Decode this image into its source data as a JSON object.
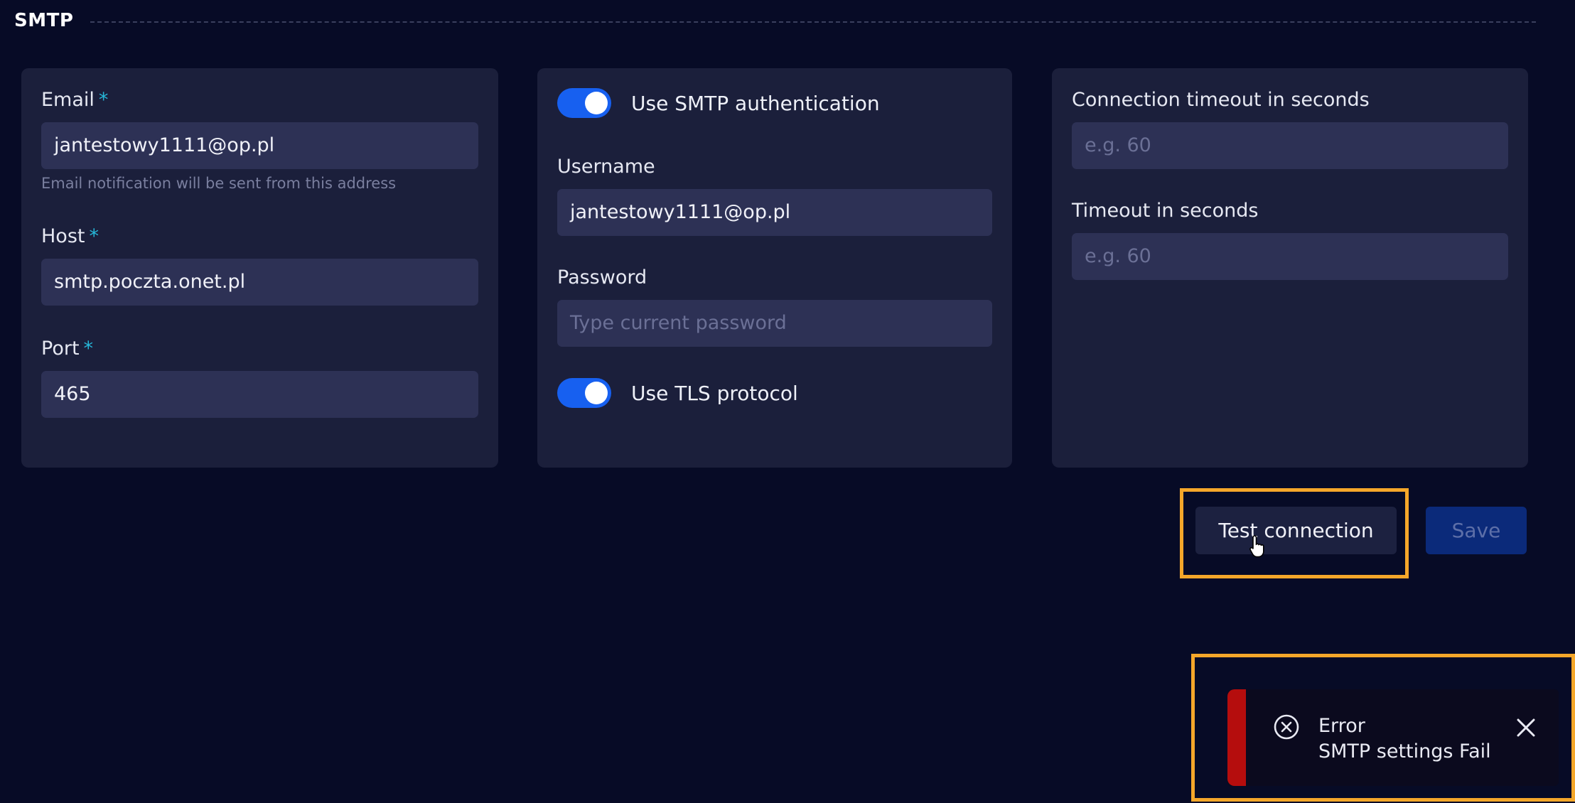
{
  "section": {
    "title": "SMTP"
  },
  "email_card": {
    "email_label": "Email",
    "email_value": "jantestowy1111@op.pl",
    "email_hint": "Email notification will be sent from this address",
    "host_label": "Host",
    "host_value": "smtp.poczta.onet.pl",
    "port_label": "Port",
    "port_value": "465",
    "required_mark": "*"
  },
  "auth_card": {
    "smtp_auth_label": "Use SMTP authentication",
    "smtp_auth_enabled": true,
    "username_label": "Username",
    "username_value": "jantestowy1111@op.pl",
    "password_label": "Password",
    "password_placeholder": "Type current password",
    "tls_label": "Use TLS protocol",
    "tls_enabled": true
  },
  "timeout_card": {
    "connection_timeout_label": "Connection timeout in seconds",
    "connection_timeout_placeholder": "e.g. 60",
    "timeout_label": "Timeout in seconds",
    "timeout_placeholder": "e.g. 60"
  },
  "actions": {
    "test_connection_label": "Test connection",
    "save_label": "Save"
  },
  "toast": {
    "title": "Error",
    "message": "SMTP settings Fail",
    "icon": "error-circle-icon"
  },
  "colors": {
    "background": "#070b26",
    "card": "#1b1f3b",
    "input": "#2d3155",
    "accent_toggle": "#1760f0",
    "required_star": "#26b7d8",
    "error_bar": "#b50d0d",
    "highlight": "#f5a72a"
  }
}
